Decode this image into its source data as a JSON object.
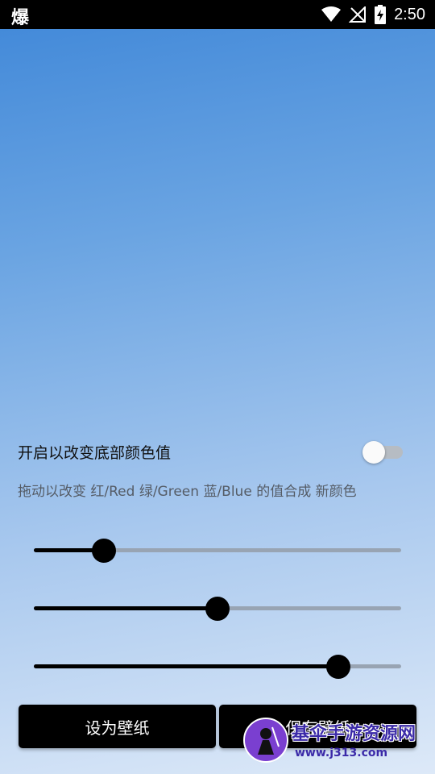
{
  "status_bar": {
    "app_glyph": "爆",
    "time": "2:50"
  },
  "toggle": {
    "label": "开启以改变底部颜色值",
    "checked": false
  },
  "hint": "拖动以改变 红/Red 绿/Green 蓝/Blue 的值合成 新颜色",
  "sliders": [
    {
      "name": "red",
      "value": 0.19
    },
    {
      "name": "green",
      "value": 0.5
    },
    {
      "name": "blue",
      "value": 0.83
    }
  ],
  "buttons": {
    "set_wallpaper": "设为壁纸",
    "save_wallpaper": "保存壁纸"
  },
  "watermark": {
    "title": "基伞手游资源网",
    "url": "www.j313.com"
  },
  "colors": {
    "accent": "#000000",
    "track": "#98a4b3",
    "gradient_top": "#3f87d8",
    "gradient_bottom": "#dde9f8"
  }
}
